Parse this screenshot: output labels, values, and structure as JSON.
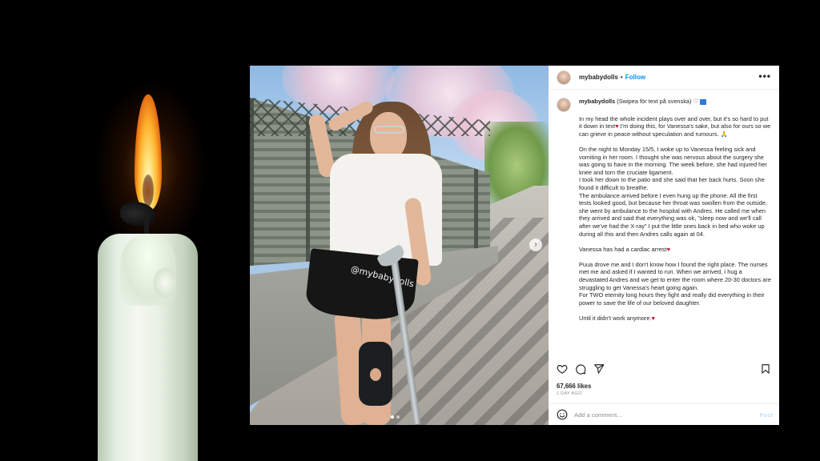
{
  "post": {
    "username": "mybabydolls",
    "separator": "•",
    "follow_label": "Follow",
    "more_label": "•••",
    "photo_overlay_text": "@mybabydolls",
    "photo_next_arrow": "›",
    "caption_header": "(Swipea för text på svenska)",
    "caption_paragraphs": [
      "In my head the whole incident plays over and over, but it's so hard to put it down in text",
      "I'm doing this, for Vanessa's sake, but also for ours so we can grieve in peace without speculation and rumours."
    ],
    "p2": "On the night to Monday 15/5, I woke up to Vanessa feeling sick and vomiting in her room. I thought she was nervous about the surgery she was going to have in the morning. The week before, she had injured her knee and torn the cruciate ligament.",
    "p3": "I took her down to the patio and she said that her back hurts. Soon she found it difficult to breathe.",
    "p4": "The ambulance arrived before I even hung up the phone. All the first tests looked good, but because her throat was swollen from the outside, she went by ambulance to the hospital with Andres. He called me when they arrived and said that everything was ok, \"sleep now and we'll call after we've had the X-ray\" I put the little ones back in bed who woke up during all this and then Andres calls again at 04.",
    "p5": "Vanessa has had a cardiac arrest",
    "p6": "Puua drove me and I don't know how I found the right place. The nurses met me and asked if I wanted to run. When we arrived, I hug a devastated Andres and we get to enter the room where 20-30 doctors are struggling to get Vanessa's heart going again.",
    "p7": "For TWO eternity long hours they fight and really did everything in their power to save the life of our beloved daughter.",
    "p8": "Until it didn't work anymore.",
    "heart_symbol": "♥",
    "praying_symbol": "🙏",
    "likes": "67,666 likes",
    "time_ago": "1 DAY AGO",
    "comment_placeholder": "Add a comment...",
    "post_button": "Post"
  },
  "icons": {
    "like": "heart-outline-icon",
    "comment": "comment-bubble-icon",
    "share": "paper-plane-icon",
    "save": "bookmark-icon",
    "emoji": "emoji-smile-icon"
  },
  "colors": {
    "link_blue": "#0095f6",
    "heart_red": "#c0162c",
    "post_disabled": "#c4e0f9"
  }
}
